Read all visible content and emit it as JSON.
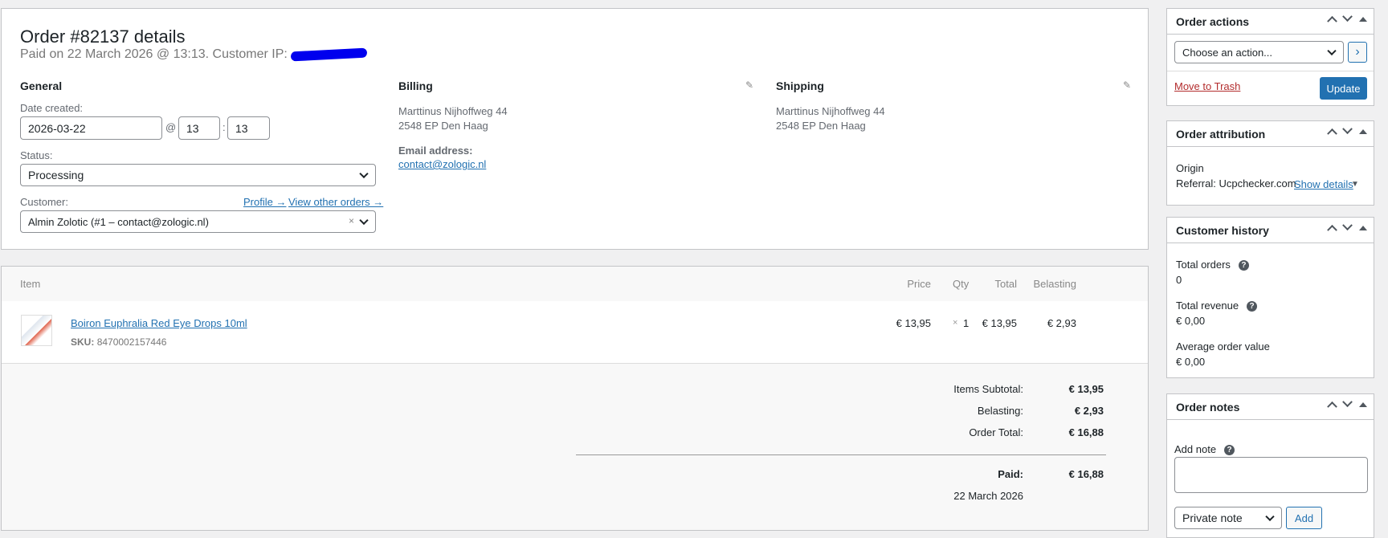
{
  "order": {
    "title": "Order #82137 details",
    "subtitle": "Paid on 22 March 2026 @ 13:13. Customer IP: ",
    "general": {
      "heading": "General",
      "date_label": "Date created:",
      "date": "2026-03-22",
      "at": "@",
      "hour": "13",
      "colon": ":",
      "minute": "13",
      "status_label": "Status:",
      "status": "Processing",
      "customer_label": "Customer:",
      "profile_link": "Profile →",
      "other_orders_link": "View other orders →",
      "customer": "Almin Zolotic (#1 – contact@zologic.nl)",
      "clear": "×"
    },
    "billing": {
      "heading": "Billing",
      "line1": "Marttinus Nijhoffweg 44",
      "line2": "2548 EP Den Haag",
      "email_label": "Email address:",
      "email": "contact@zologic.nl"
    },
    "shipping": {
      "heading": "Shipping",
      "line1": "Marttinus Nijhoffweg 44",
      "line2": "2548 EP Den Haag"
    }
  },
  "items": {
    "headers": {
      "item": "Item",
      "price": "Price",
      "qty": "Qty",
      "total": "Total",
      "tax": "Belasting"
    },
    "rows": [
      {
        "name": "Boiron Euphralia Red Eye Drops 10ml",
        "sku_label": "SKU:",
        "sku": "8470002157446",
        "price": "€ 13,95",
        "qty_x": "×",
        "qty": "1",
        "total": "€ 13,95",
        "tax": "€ 2,93"
      }
    ],
    "totals": {
      "subtotal_label": "Items Subtotal:",
      "subtotal": "€ 13,95",
      "tax_label": "Belasting:",
      "tax": "€ 2,93",
      "total_label": "Order Total:",
      "total": "€ 16,88",
      "paid_label": "Paid:",
      "paid": "€ 16,88",
      "paid_date": "22 March 2026"
    }
  },
  "sidebar": {
    "actions": {
      "title": "Order actions",
      "select": "Choose an action...",
      "go": "›",
      "trash": "Move to Trash",
      "update": "Update"
    },
    "attribution": {
      "title": "Order attribution",
      "origin_label": "Origin",
      "origin": "Referral: Ucpchecker.com",
      "show_details": "Show details"
    },
    "history": {
      "title": "Customer history",
      "orders_label": "Total orders",
      "orders": "0",
      "revenue_label": "Total revenue",
      "revenue": "€ 0,00",
      "aov_label": "Average order value",
      "aov": "€ 0,00"
    },
    "notes": {
      "title": "Order notes",
      "add_label": "Add note",
      "type": "Private note",
      "add": "Add"
    }
  }
}
